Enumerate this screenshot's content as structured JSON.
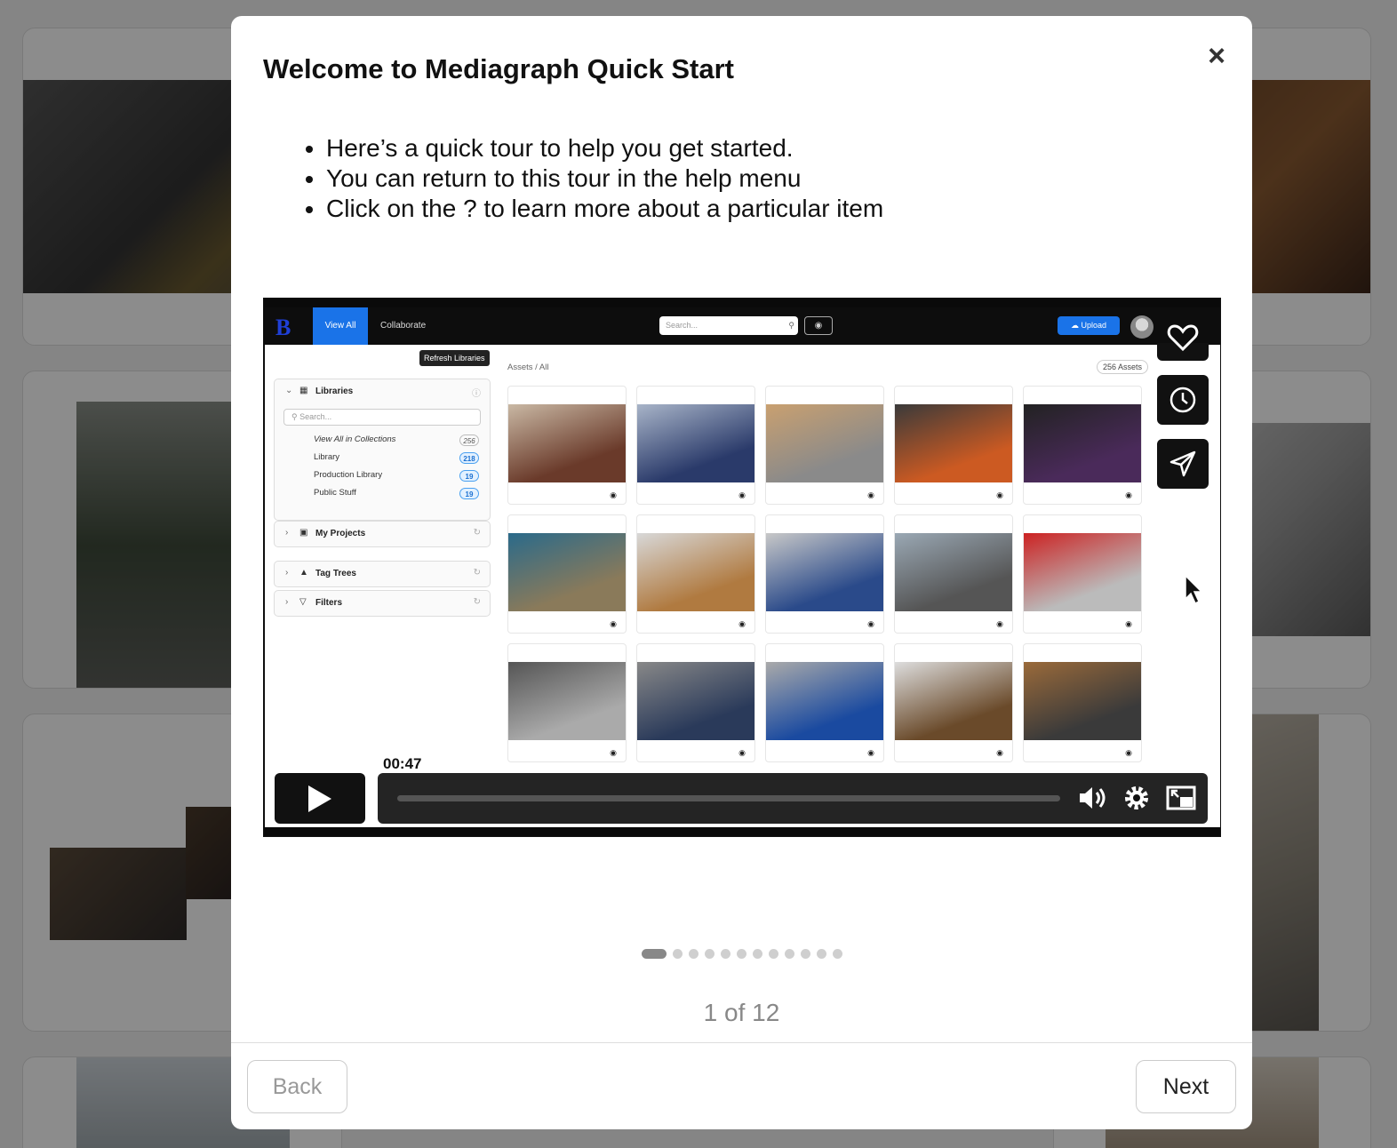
{
  "modal": {
    "title": "Welcome to Mediagraph Quick Start",
    "close_label": "×",
    "bullets": [
      "Here’s a quick tour to help you get started.",
      "You can return to this tour in the help menu",
      "Click on the ? to learn more about a particular item"
    ],
    "pager": "1 of 12",
    "current_slide": 1,
    "total_slides": 12,
    "back_label": "Back",
    "next_label": "Next"
  },
  "video": {
    "app": {
      "logo": "B",
      "tabs": [
        "View All",
        "Collaborate"
      ],
      "search_placeholder": "Search...",
      "upload_label": "Upload",
      "tooltip": "Refresh Libraries",
      "libraries_title": "Libraries",
      "libraries_search_placeholder": "Search...",
      "library_rows": [
        {
          "label": "View All in Collections",
          "count": "256"
        },
        {
          "label": "Library",
          "count": "218"
        },
        {
          "label": "Production Library",
          "count": "19"
        },
        {
          "label": "Public Stuff",
          "count": "19"
        }
      ],
      "sections": [
        "My Projects",
        "Tag Trees",
        "Filters"
      ],
      "breadcrumb": "Assets  /  All",
      "asset_count": "256 Assets"
    },
    "time_tooltip": "00:47",
    "progress_fraction": 0.0,
    "icons": [
      "heart-icon",
      "clock-icon",
      "send-icon",
      "play-icon",
      "volume-icon",
      "settings-icon",
      "pip-icon"
    ]
  }
}
